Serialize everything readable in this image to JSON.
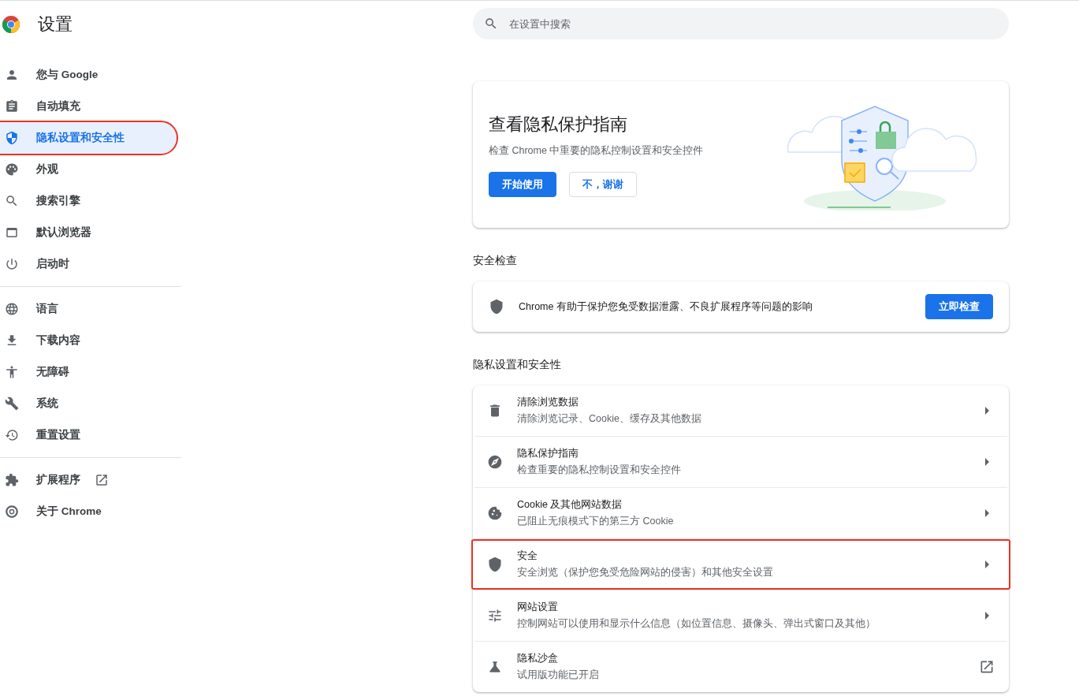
{
  "header": {
    "title": "设置"
  },
  "search": {
    "placeholder": "在设置中搜索"
  },
  "sidebar": {
    "groups": [
      {
        "items": [
          {
            "label": "您与 Google",
            "selected": false,
            "highlighted": false,
            "external": false
          },
          {
            "label": "自动填充",
            "selected": false,
            "highlighted": false,
            "external": false
          },
          {
            "label": "隐私设置和安全性",
            "selected": true,
            "highlighted": true,
            "external": false
          },
          {
            "label": "外观",
            "selected": false,
            "highlighted": false,
            "external": false
          },
          {
            "label": "搜索引擎",
            "selected": false,
            "highlighted": false,
            "external": false
          },
          {
            "label": "默认浏览器",
            "selected": false,
            "highlighted": false,
            "external": false
          },
          {
            "label": "启动时",
            "selected": false,
            "highlighted": false,
            "external": false
          }
        ]
      },
      {
        "items": [
          {
            "label": "语言",
            "selected": false,
            "highlighted": false,
            "external": false
          },
          {
            "label": "下载内容",
            "selected": false,
            "highlighted": false,
            "external": false
          },
          {
            "label": "无障碍",
            "selected": false,
            "highlighted": false,
            "external": false
          },
          {
            "label": "系统",
            "selected": false,
            "highlighted": false,
            "external": false
          },
          {
            "label": "重置设置",
            "selected": false,
            "highlighted": false,
            "external": false
          }
        ]
      },
      {
        "items": [
          {
            "label": "扩展程序",
            "selected": false,
            "highlighted": false,
            "external": true
          },
          {
            "label": "关于 Chrome",
            "selected": false,
            "highlighted": false,
            "external": false
          }
        ]
      }
    ]
  },
  "guide_card": {
    "title": "查看隐私保护指南",
    "description": "检查 Chrome 中重要的隐私控制设置和安全控件",
    "buttons": [
      {
        "label": "开始使用",
        "kind": "primary"
      },
      {
        "label": "不，谢谢",
        "kind": "secondary"
      }
    ]
  },
  "safety_check": {
    "heading": "安全检查",
    "text": "Chrome 有助于保护您免受数据泄露、不良扩展程序等问题的影响",
    "button": "立即检查"
  },
  "privacy_section": {
    "heading": "隐私设置和安全性",
    "rows": [
      {
        "title": "清除浏览数据",
        "subtitle": "清除浏览记录、Cookie、缓存及其他数据",
        "external": false,
        "highlighted": false
      },
      {
        "title": "隐私保护指南",
        "subtitle": "检查重要的隐私控制设置和安全控件",
        "external": false,
        "highlighted": false
      },
      {
        "title": "Cookie 及其他网站数据",
        "subtitle": "已阻止无痕模式下的第三方 Cookie",
        "external": false,
        "highlighted": false
      },
      {
        "title": "安全",
        "subtitle": "安全浏览（保护您免受危险网站的侵害）和其他安全设置",
        "external": false,
        "highlighted": true
      },
      {
        "title": "网站设置",
        "subtitle": "控制网站可以使用和显示什么信息（如位置信息、摄像头、弹出式窗口及其他）",
        "external": false,
        "highlighted": false
      },
      {
        "title": "隐私沙盒",
        "subtitle": "试用版功能已开启",
        "external": true,
        "highlighted": false
      }
    ]
  }
}
